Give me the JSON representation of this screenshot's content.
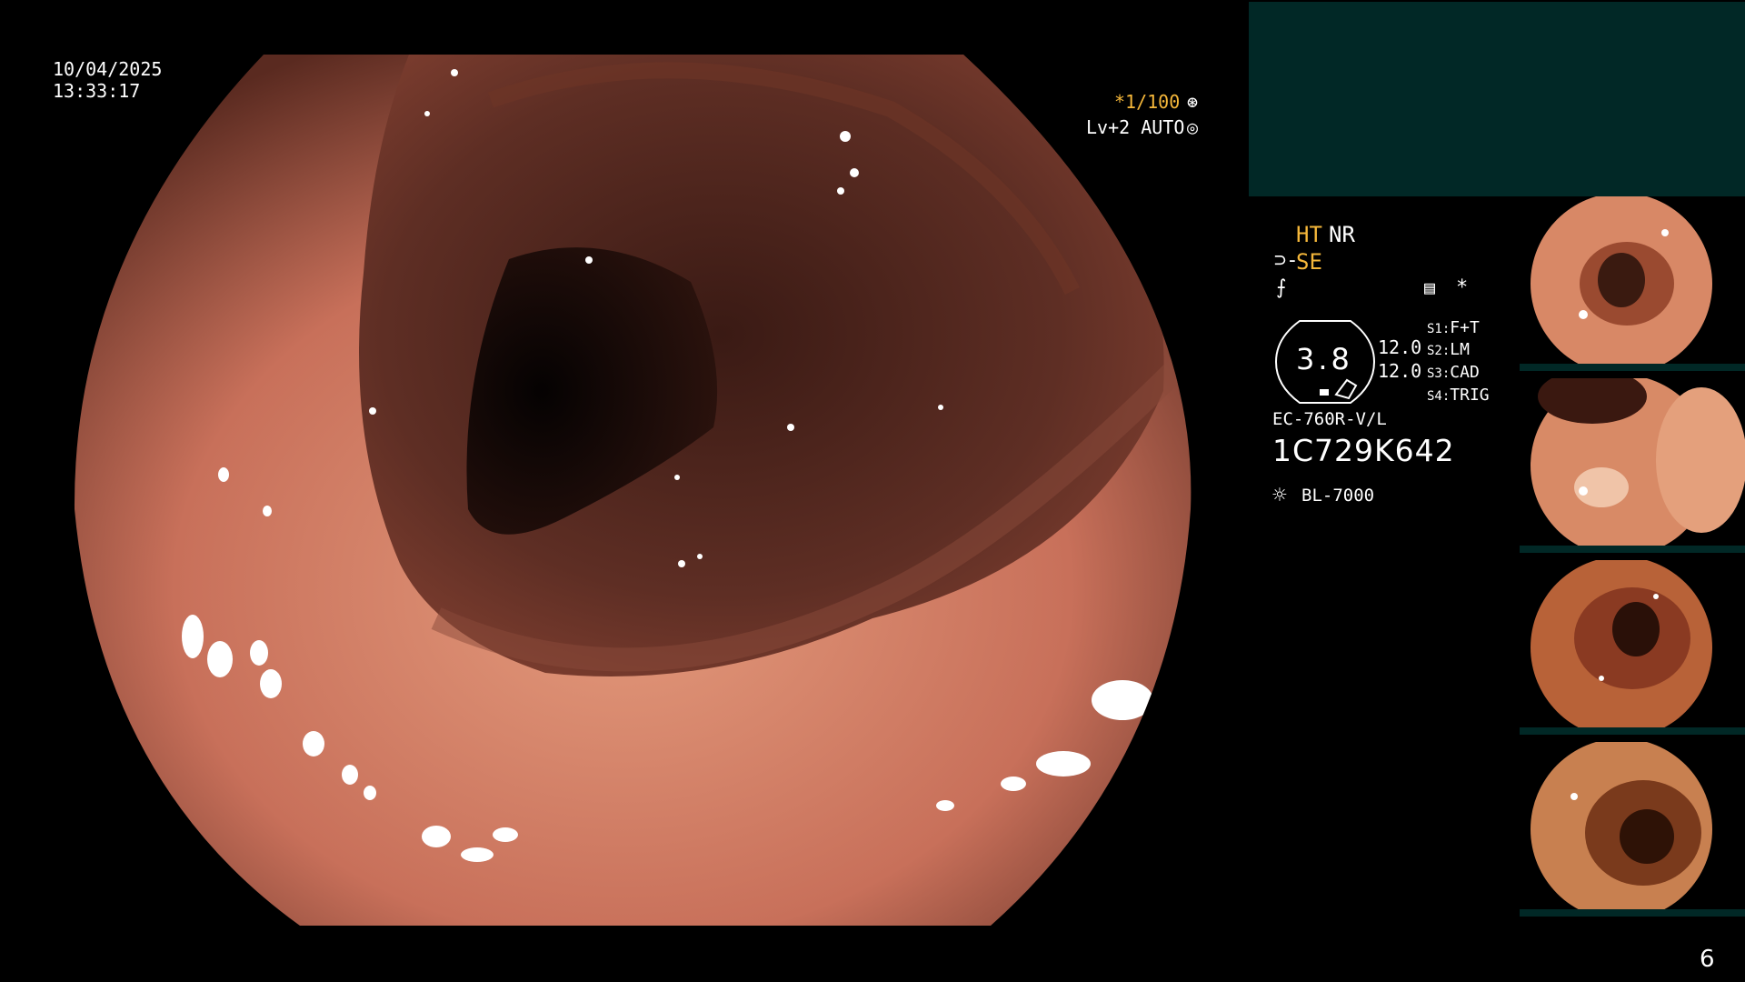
{
  "overlay": {
    "date": "10/04/2025",
    "time": "13:33:17",
    "shutter": "*1/100",
    "shutter_icon": "aperture-icon",
    "light_level": "Lv+2 AUTO",
    "light_icon": "auto-iris-icon"
  },
  "info": {
    "ht": "HT",
    "nr": "NR",
    "se_symbol": "⊃-",
    "se": "SE",
    "f_symbol": "⨍",
    "memo_icon": "memo-icon",
    "star": "*",
    "zoom_value": "3.8",
    "value_a": "12.0",
    "value_b": "12.0",
    "switches": [
      {
        "key": "S1:",
        "value": "F+T"
      },
      {
        "key": "S2:",
        "value": "LM"
      },
      {
        "key": "S3:",
        "value": "CAD"
      },
      {
        "key": "S4:",
        "value": "TRIG"
      }
    ],
    "scope_model": "EC-760R-V/L",
    "scope_serial": "1C729K642",
    "light_source_icon": "sun-icon",
    "light_source": "BL-7000"
  },
  "thumbnails": [
    {
      "label": "thumbnail-1"
    },
    {
      "label": "thumbnail-2"
    },
    {
      "label": "thumbnail-3"
    },
    {
      "label": "thumbnail-4"
    }
  ],
  "page_number": "6",
  "colors": {
    "accent_orange": "#f5b73a",
    "panel_teal": "#012826",
    "background": "#000000"
  }
}
